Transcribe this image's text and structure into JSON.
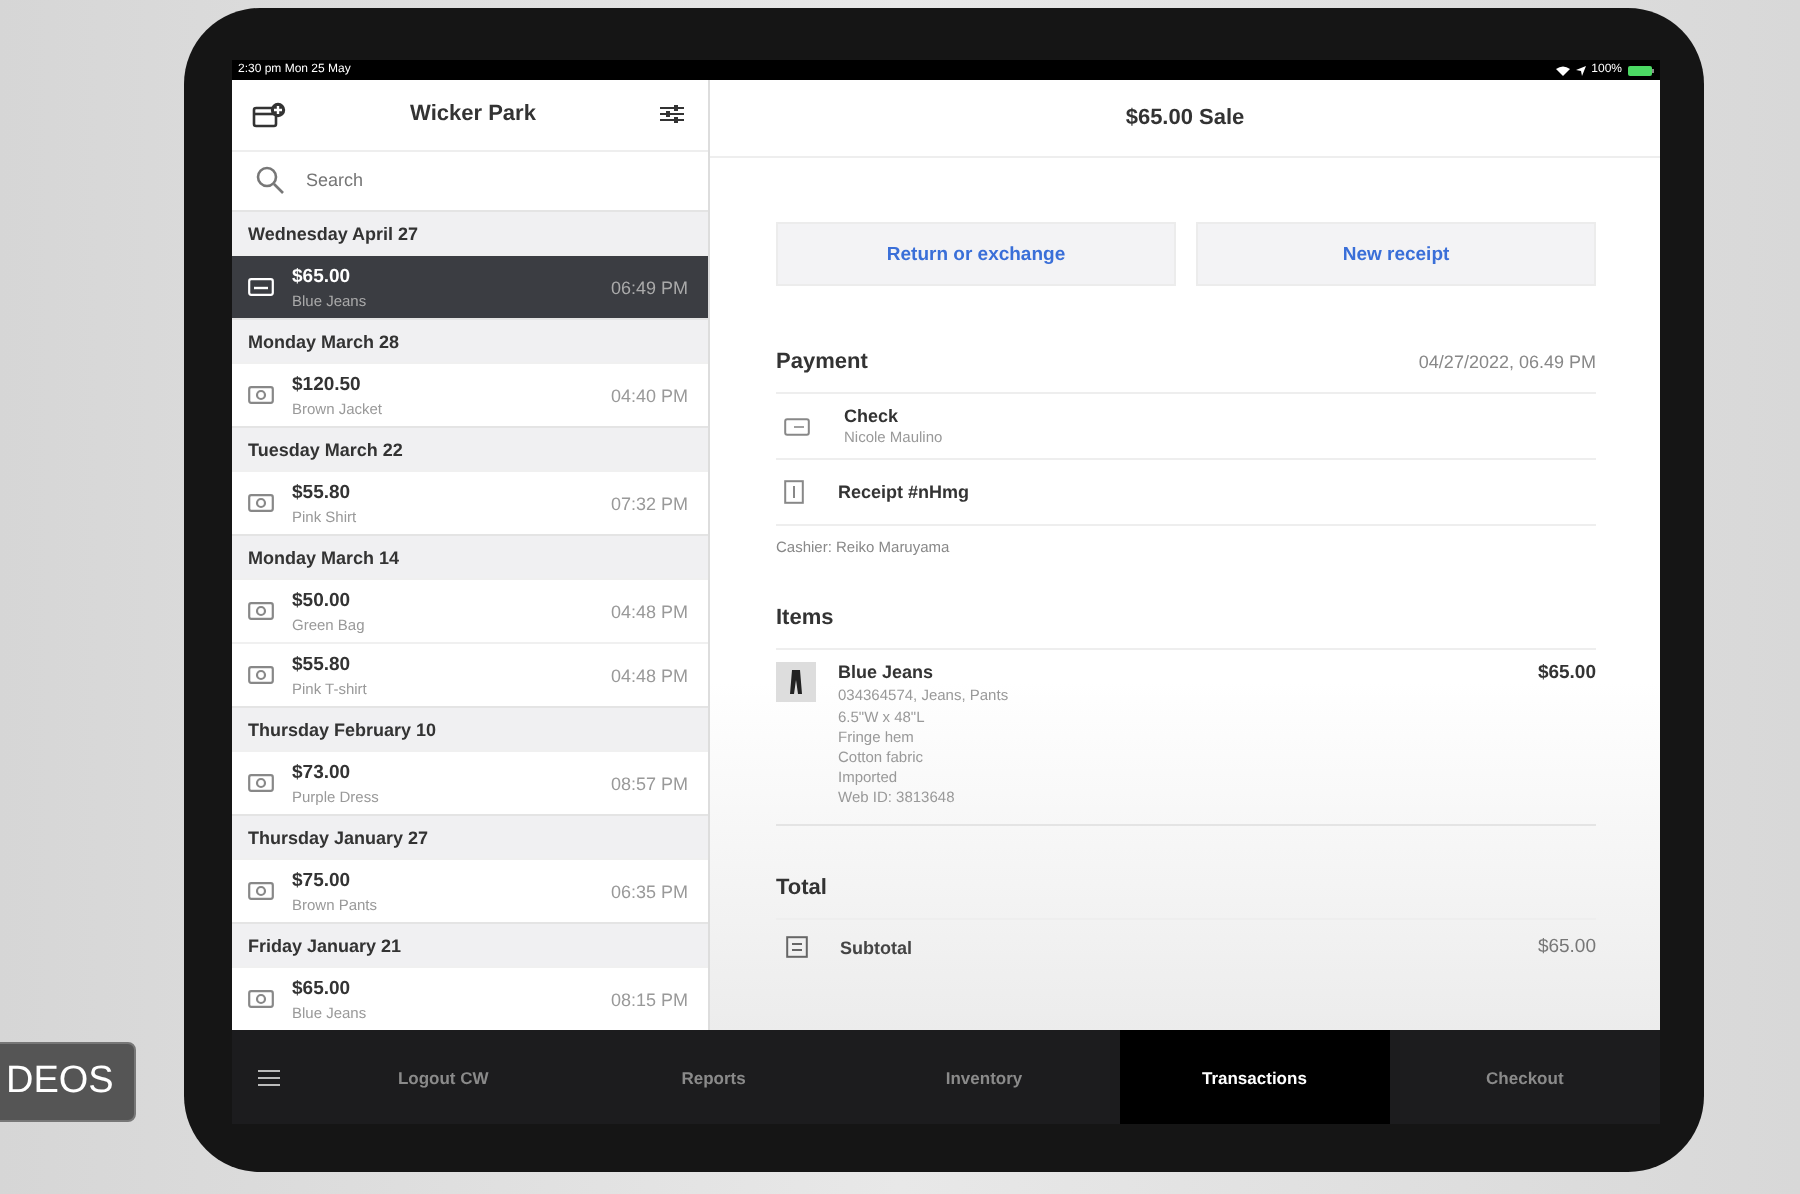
{
  "overlay_badge": "DEOS",
  "status_bar": {
    "time": "2:30 pm  Mon 25 May",
    "battery": "100%"
  },
  "sidebar": {
    "title": "Wicker Park",
    "search": {
      "placeholder": "Search"
    },
    "groups": [
      {
        "date": "Wednesday April 27",
        "items": [
          {
            "kind": "card",
            "amount": "$65.00",
            "item": "Blue Jeans",
            "time": "06:49 PM",
            "selected": true
          }
        ]
      },
      {
        "date": "Monday March 28",
        "items": [
          {
            "kind": "cash",
            "amount": "$120.50",
            "item": "Brown Jacket",
            "time": "04:40 PM",
            "selected": false
          }
        ]
      },
      {
        "date": "Tuesday March 22",
        "items": [
          {
            "kind": "cash",
            "amount": "$55.80",
            "item": "Pink Shirt",
            "time": "07:32 PM",
            "selected": false
          }
        ]
      },
      {
        "date": "Monday March 14",
        "items": [
          {
            "kind": "cash",
            "amount": "$50.00",
            "item": "Green Bag",
            "time": "04:48 PM",
            "selected": false
          },
          {
            "kind": "cash",
            "amount": "$55.80",
            "item": "Pink T-shirt",
            "time": "04:48 PM",
            "selected": false
          }
        ]
      },
      {
        "date": "Thursday February 10",
        "items": [
          {
            "kind": "cash",
            "amount": "$73.00",
            "item": "Purple Dress",
            "time": "08:57 PM",
            "selected": false
          }
        ]
      },
      {
        "date": "Thursday January 27",
        "items": [
          {
            "kind": "cash",
            "amount": "$75.00",
            "item": "Brown Pants",
            "time": "06:35 PM",
            "selected": false
          }
        ]
      },
      {
        "date": "Friday January 21",
        "items": [
          {
            "kind": "cash",
            "amount": "$65.00",
            "item": "Blue Jeans",
            "time": "08:15 PM",
            "selected": false
          }
        ]
      }
    ]
  },
  "detail": {
    "title": "$65.00 Sale",
    "actions": [
      "Return or exchange",
      "New receipt"
    ],
    "payment": {
      "heading": "Payment",
      "date": "04/27/2022, 06.49 PM",
      "rows": [
        {
          "kind": "check",
          "title": "Check",
          "subtitle": "Nicole Maulino"
        },
        {
          "kind": "receipt",
          "title": "Receipt #nHmg"
        }
      ],
      "cashier": "Cashier: Reiko Maruyama"
    },
    "items": {
      "heading": "Items",
      "list": [
        {
          "name": "Blue Jeans",
          "price": "$65.00",
          "details": [
            "034364574, Jeans, Pants",
            "6.5\"W x 48\"L",
            "Fringe hem",
            "Cotton fabric",
            "Imported",
            "Web ID: 3813648"
          ]
        }
      ]
    },
    "total": {
      "heading": "Total",
      "rows": [
        {
          "label": "Subtotal",
          "value": "$65.00"
        }
      ]
    }
  },
  "tab_bar": {
    "tabs": [
      {
        "label": "Logout CW",
        "selected": false
      },
      {
        "label": "Reports",
        "selected": false
      },
      {
        "label": "Inventory",
        "selected": false
      },
      {
        "label": "Transactions",
        "selected": true
      },
      {
        "label": "Checkout",
        "selected": false
      }
    ]
  }
}
